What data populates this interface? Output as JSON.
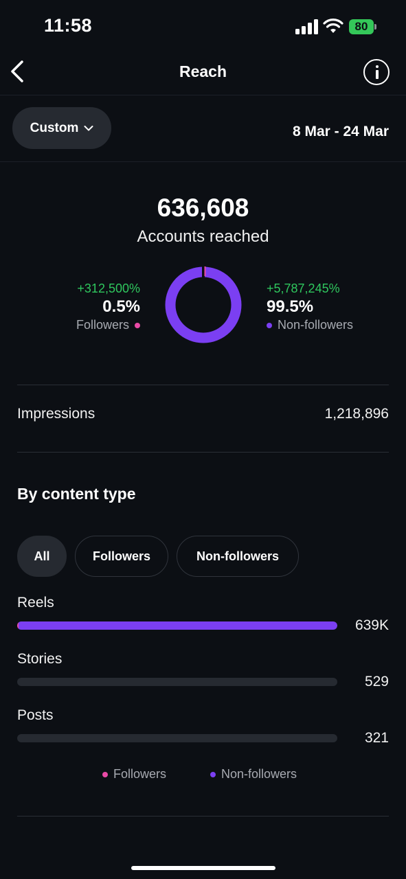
{
  "status_bar": {
    "time": "11:58",
    "battery": "80"
  },
  "nav": {
    "title": "Reach"
  },
  "range": {
    "selector_label": "Custom",
    "dates": "8 Mar - 24 Mar"
  },
  "summary": {
    "total": "636,608",
    "total_label": "Accounts reached",
    "followers": {
      "change": "+312,500%",
      "percent": "0.5%",
      "label": "Followers",
      "fraction": 0.005
    },
    "non_followers": {
      "change": "+5,787,245%",
      "percent": "99.5%",
      "label": "Non-followers",
      "fraction": 0.995
    }
  },
  "impressions": {
    "label": "Impressions",
    "value": "1,218,896"
  },
  "content_type": {
    "title": "By content type",
    "filters": [
      "All",
      "Followers",
      "Non-followers"
    ],
    "active_filter": "All",
    "rows": [
      {
        "label": "Reels",
        "value": "639K",
        "followers_fraction": 0.01,
        "non_followers_fraction": 1.0
      },
      {
        "label": "Stories",
        "value": "529",
        "followers_fraction": 0,
        "non_followers_fraction": 0
      },
      {
        "label": "Posts",
        "value": "321",
        "followers_fraction": 0,
        "non_followers_fraction": 0
      }
    ],
    "legend": [
      "Followers",
      "Non-followers"
    ]
  },
  "colors": {
    "followers": "#e94aa6",
    "non_followers": "#7b3ff2",
    "positive": "#2fc75e",
    "battery": "#34c759"
  }
}
